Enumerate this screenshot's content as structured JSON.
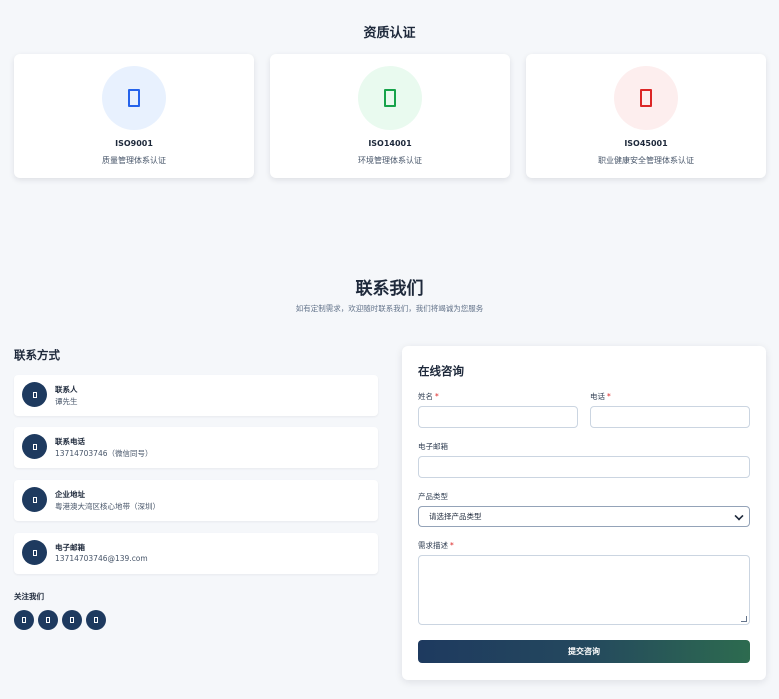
{
  "certifications": {
    "title": "资质认证",
    "items": [
      {
        "code": "ISO9001",
        "desc": "质量管理体系认证",
        "icon": "document-icon",
        "color": "#2563eb",
        "bg": "#e8f1fe"
      },
      {
        "code": "ISO14001",
        "desc": "环境管理体系认证",
        "icon": "document-icon",
        "color": "#16a34a",
        "bg": "#e9faef"
      },
      {
        "code": "ISO45001",
        "desc": "职业健康安全管理体系认证",
        "icon": "document-icon",
        "color": "#dc2626",
        "bg": "#fdeeee"
      }
    ]
  },
  "contact": {
    "title": "联系我们",
    "subtitle": "如有定制需求，欢迎随时联系我们，我们将竭诚为您服务",
    "methods_title": "联系方式",
    "methods": [
      {
        "label": "联系人",
        "value": "谭先生",
        "icon": "user-icon"
      },
      {
        "label": "联系电话",
        "value": "13714703746（微信同号）",
        "icon": "phone-icon"
      },
      {
        "label": "企业地址",
        "value": "粤港澳大湾区核心地带（深圳）",
        "icon": "location-icon"
      },
      {
        "label": "电子邮箱",
        "value": "13714703746@139.com",
        "icon": "mail-icon"
      }
    ],
    "follow_title": "关注我们",
    "social_icons": [
      "wechat-icon",
      "weibo-icon",
      "qq-icon",
      "phone-icon"
    ]
  },
  "form": {
    "title": "在线咨询",
    "name_label": "姓名",
    "phone_label": "电话",
    "email_label": "电子邮箱",
    "product_label": "产品类型",
    "product_selected": "请选择产品类型",
    "desc_label": "需求描述",
    "required_mark": "*",
    "submit_label": "提交咨询"
  },
  "colors": {
    "primary": "#1e3a5f",
    "accent_green": "#2d6b4f",
    "required": "#dc2626"
  }
}
